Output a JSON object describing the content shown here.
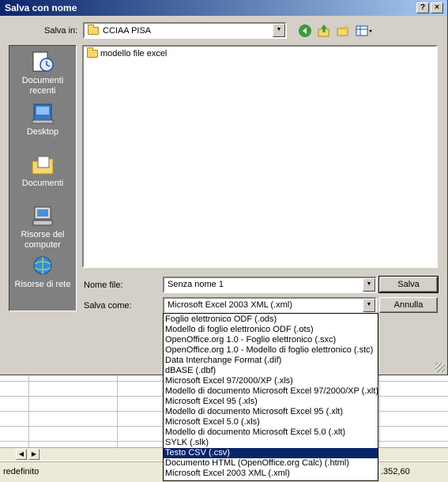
{
  "dialog": {
    "title": "Salva con nome",
    "help_label": "?",
    "close_label": "×",
    "save_in_label": "Salva in:",
    "save_in_value": "CCIAA PISA",
    "filename_label": "Nome file:",
    "filename_value": "Senza nome 1",
    "save_as_label": "Salva come:",
    "save_as_value": "Microsoft Excel 2003 XML (.xml)",
    "save_button": "Salva",
    "cancel_button": "Annulla"
  },
  "places": [
    {
      "label": "Documenti recenti",
      "icon": "recent-documents-icon"
    },
    {
      "label": "Desktop",
      "icon": "desktop-icon"
    },
    {
      "label": "Documenti",
      "icon": "documents-icon"
    },
    {
      "label": "Risorse del computer",
      "icon": "my-computer-icon"
    },
    {
      "label": "Risorse di rete",
      "icon": "network-icon"
    }
  ],
  "files": [
    {
      "name": "modello file excel",
      "icon": "folder-icon"
    }
  ],
  "file_types": [
    "Foglio elettronico ODF (.ods)",
    "Modello di foglio elettronico ODF (.ots)",
    "OpenOffice.org 1.0 - Foglio elettronico (.sxc)",
    "OpenOffice.org 1.0 - Modello di foglio elettronico (.stc)",
    "Data Interchange Format (.dif)",
    "dBASE (.dbf)",
    "Microsoft Excel 97/2000/XP (.xls)",
    "Modello di documento Microsoft Excel 97/2000/XP (.xlt)",
    "Microsoft Excel 95 (.xls)",
    "Modello di documento Microsoft Excel 95 (.xlt)",
    "Microsoft Excel 5.0 (.xls)",
    "Modello di documento Microsoft Excel 5.0 (.xlt)",
    "SYLK (.slk)",
    "Testo CSV (.csv)",
    "Documento HTML (OpenOffice.org Calc) (.html)",
    "Microsoft Excel 2003 XML (.xml)"
  ],
  "selected_file_type": "Testo CSV (.csv)",
  "statusbar": {
    "left_text": "redefinito",
    "right_text": ".352,60"
  },
  "toolbar_icons": [
    "back-icon",
    "up-folder-icon",
    "new-folder-icon",
    "view-menu-icon"
  ],
  "colors": {
    "title_bar": "#0a246a",
    "selection": "#0a246a",
    "dialog_bg": "#d4d0c8"
  }
}
